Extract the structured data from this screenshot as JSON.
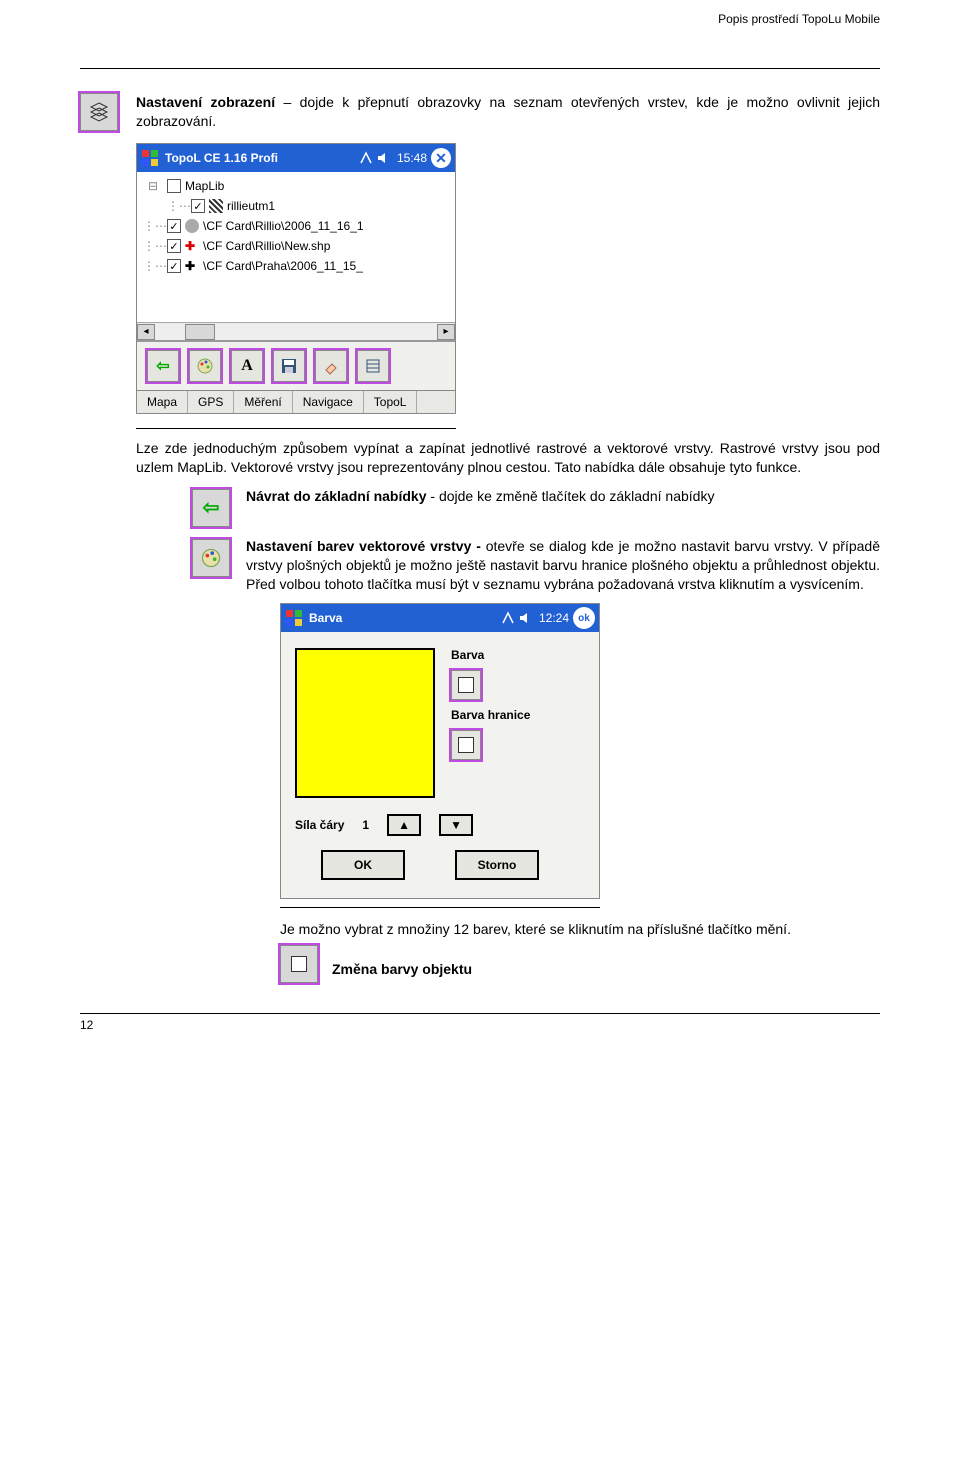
{
  "header": {
    "right": "Popis prostředí TopoLu Mobile"
  },
  "intro": {
    "bold": "Nastavení zobrazení",
    "rest": " – dojde k přepnutí obrazovky na seznam otevřených vrstev, kde je možno ovlivnit jejich zobrazování."
  },
  "shot1": {
    "title": "TopoL CE 1.16 Profi",
    "time": "15:48",
    "tree": {
      "root": "MapLib",
      "items": [
        {
          "label": "rillieutm1",
          "checked": true,
          "swatch": "striped"
        },
        {
          "label": "\\CF Card\\Rillio\\2006_11_16_1",
          "checked": true,
          "swatch": "gray"
        },
        {
          "label": "\\CF Card\\Rillio\\New.shp",
          "checked": true,
          "swatch": "redcross"
        },
        {
          "label": "\\CF Card\\Praha\\2006_11_15_",
          "checked": true,
          "swatch": "plus"
        }
      ]
    },
    "tabs": [
      "Mapa",
      "GPS",
      "Měření",
      "Navigace",
      "TopoL"
    ]
  },
  "para2": "Lze zde jednoduchým způsobem vypínat a zapínat jednotlivé rastrové a vektorové vrstvy. Rastrové vrstvy jsou pod uzlem MapLib. Vektorové vrstvy jsou reprezentovány plnou cestou. Tato nabídka dále obsahuje tyto funkce.",
  "bullet1": {
    "bold": "Návrat do základní nabídky",
    "rest": " - dojde ke změně tlačítek do základní nabídky"
  },
  "bullet2": {
    "bold": "Nastavení barev vektorové vrstvy -",
    "rest": " otevře se dialog kde je možno nastavit barvu vrstvy. V případě vrstvy plošných objektů je možno ještě nastavit barvu hranice plošného objektu a průhlednost objektu. Před volbou tohoto tlačítka musí být v seznamu vybrána požadovaná vrstva kliknutím a vysvícením."
  },
  "shot2": {
    "title": "Barva",
    "time": "12:24",
    "label_color": "Barva",
    "label_border": "Barva hranice",
    "label_thickness": "Síla čáry",
    "thickness_value": "1",
    "ok": "OK",
    "cancel": "Storno"
  },
  "final": {
    "text": "Je možno vybrat z množiny 12 barev, které se kliknutím na příslušné tlačítko mění.",
    "caption": "Změna barvy objektu"
  },
  "page_number": "12"
}
